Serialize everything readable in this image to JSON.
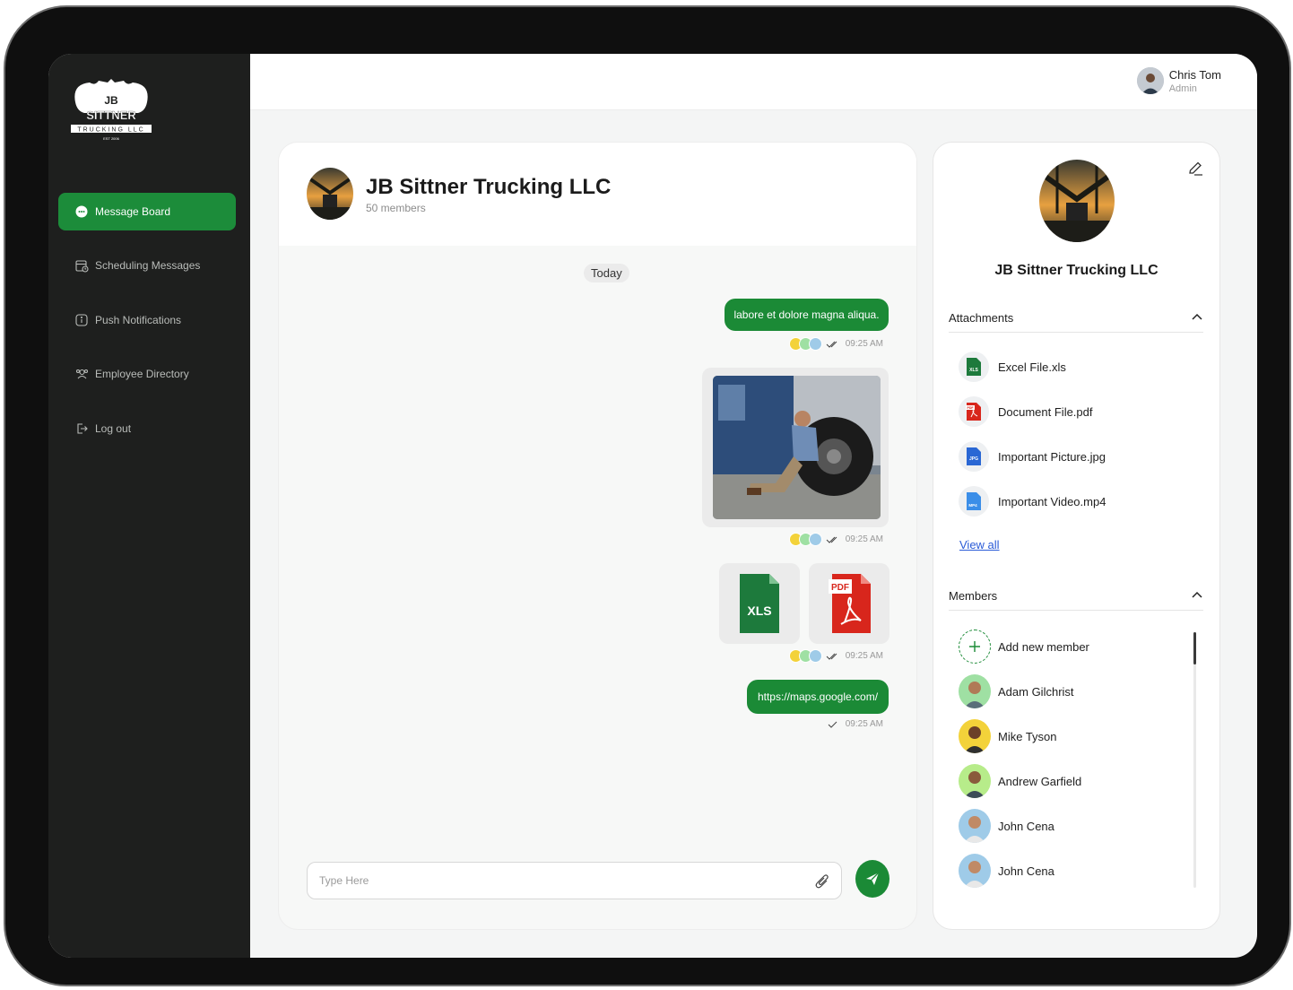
{
  "app": {
    "logo_text_line1": "JB",
    "logo_text_line2": "SITTNER",
    "logo_text_line3": "TRUCKING LLC",
    "logo_text_line4": "EST 2006"
  },
  "sidebar": {
    "items": [
      {
        "label": "Message Board",
        "icon": "chat-bubble-icon",
        "active": true
      },
      {
        "label": "Scheduling Messages",
        "icon": "calendar-clock-icon",
        "active": false
      },
      {
        "label": "Push Notifications",
        "icon": "info-icon",
        "active": false
      },
      {
        "label": "Employee Directory",
        "icon": "people-icon",
        "active": false
      },
      {
        "label": "Log out",
        "icon": "logout-icon",
        "active": false
      }
    ]
  },
  "header": {
    "user_name": "Chris Tom",
    "user_role": "Admin"
  },
  "chat": {
    "group_name": "JB Sittner Trucking LLC",
    "members_count": "50 members",
    "date_divider": "Today",
    "messages": [
      {
        "type": "text",
        "text": "labore et dolore magna aliqua.",
        "time": "09:25 AM",
        "status": "read"
      },
      {
        "type": "image",
        "time": "09:25 AM",
        "status": "read"
      },
      {
        "type": "files",
        "files": [
          "XLS",
          "PDF"
        ],
        "time": "09:25 AM",
        "status": "read"
      },
      {
        "type": "text",
        "text": "https://maps.google.com/",
        "time": "09:25 AM",
        "status": "sent"
      }
    ],
    "input_placeholder": "Type Here"
  },
  "info_panel": {
    "group_name": "JB Sittner Trucking LLC",
    "attachments_title": "Attachments",
    "attachments": [
      {
        "name": "Excel File.xls",
        "icon": "xls-file-icon",
        "badge": "XLS"
      },
      {
        "name": "Document File.pdf",
        "icon": "pdf-file-icon",
        "badge": "PDF"
      },
      {
        "name": "Important Picture.jpg",
        "icon": "jpg-file-icon",
        "badge": "JPG"
      },
      {
        "name": "Important Video.mp4",
        "icon": "mp4-file-icon",
        "badge": "MP4"
      }
    ],
    "view_all": "View all",
    "members_title": "Members",
    "add_member": "Add new member",
    "members": [
      {
        "name": "Adam Gilchrist",
        "bg": "#9fe0a3"
      },
      {
        "name": "Mike Tyson",
        "bg": "#f3d23a"
      },
      {
        "name": "Andrew Garfield",
        "bg": "#b7ec8a"
      },
      {
        "name": "John Cena",
        "bg": "#9fcbe8"
      },
      {
        "name": "John Cena",
        "bg": "#9fcbe8"
      }
    ]
  },
  "colors": {
    "accent": "#1b8a36",
    "sidebar_bg": "#1e1f1e",
    "link": "#2a5bd7"
  }
}
